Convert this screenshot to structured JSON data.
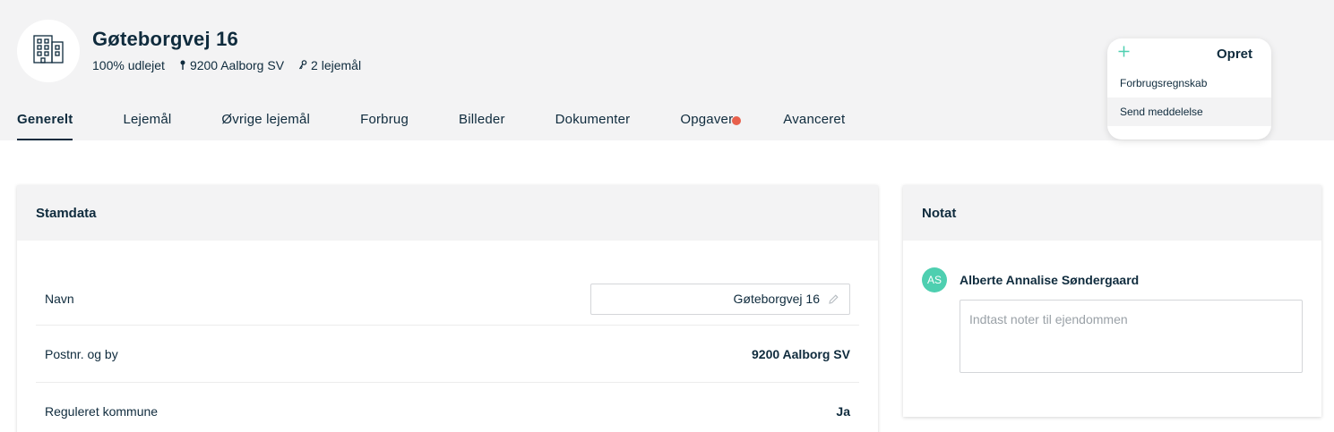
{
  "property": {
    "title": "Gøteborgvej 16",
    "occupancy": "100% udlejet",
    "location": "9200 Aalborg SV",
    "units": "2 lejemål",
    "icon": "building-icon"
  },
  "tabs": [
    {
      "label": "Generelt",
      "active": true
    },
    {
      "label": "Lejemål"
    },
    {
      "label": "Øvrige lejemål"
    },
    {
      "label": "Forbrug"
    },
    {
      "label": "Billeder"
    },
    {
      "label": "Dokumenter"
    },
    {
      "label": "Opgaver",
      "notification": true
    },
    {
      "label": "Avanceret"
    }
  ],
  "create_menu": {
    "label": "Opret",
    "items": [
      "Forbrugsregnskab",
      "Send meddelelse"
    ]
  },
  "stamdata": {
    "title": "Stamdata",
    "rows": [
      {
        "label": "Navn",
        "value": "Gøteborgvej 16",
        "editable": true
      },
      {
        "label": "Postnr. og by",
        "value": "9200 Aalborg SV"
      },
      {
        "label": "Reguleret kommune",
        "value": "Ja"
      }
    ]
  },
  "notat": {
    "title": "Notat",
    "user_initials": "AS",
    "user_name": "Alberte Annalise Søndergaard",
    "placeholder": "Indtast noter til ejendommen"
  },
  "colors": {
    "primary": "#0f2b3d",
    "accent": "#4ecfb0",
    "notification": "#e8604c",
    "band": "#f3f3f4"
  }
}
